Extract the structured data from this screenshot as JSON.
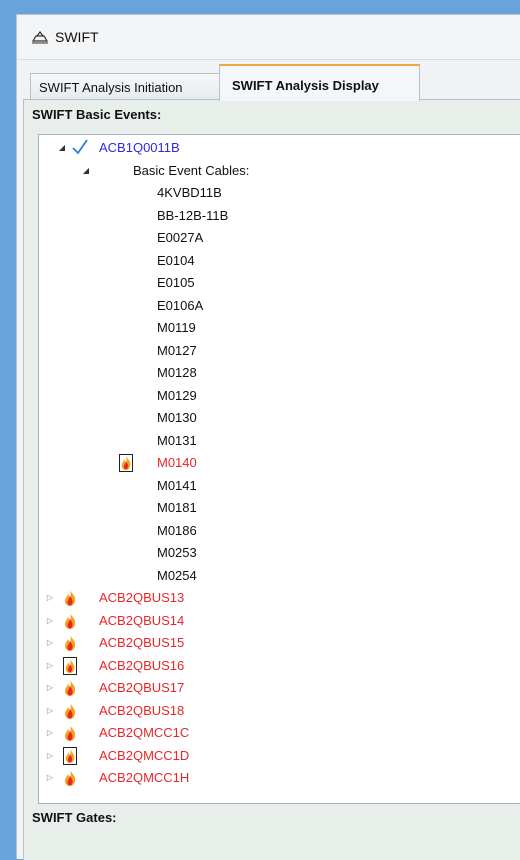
{
  "window": {
    "title": "SWIFT"
  },
  "tabs": [
    {
      "label": "SWIFT Analysis Initiation",
      "active": false
    },
    {
      "label": "SWIFT Analysis Display",
      "active": true
    }
  ],
  "basic_events_header": "SWIFT Basic Events:",
  "gates_header": "SWIFT Gates:",
  "root_event": {
    "label": "ACB1Q0011B",
    "status": "checked",
    "color": "#2b2be0"
  },
  "cables_header": "Basic Event Cables:",
  "cables": [
    {
      "label": "4KVBD11B",
      "flagged": false
    },
    {
      "label": "BB-12B-11B",
      "flagged": false
    },
    {
      "label": "E0027A",
      "flagged": false
    },
    {
      "label": "E0104",
      "flagged": false
    },
    {
      "label": "E0105",
      "flagged": false
    },
    {
      "label": "E0106A",
      "flagged": false
    },
    {
      "label": "M0119",
      "flagged": false
    },
    {
      "label": "M0127",
      "flagged": false
    },
    {
      "label": "M0128",
      "flagged": false
    },
    {
      "label": "M0129",
      "flagged": false
    },
    {
      "label": "M0130",
      "flagged": false
    },
    {
      "label": "M0131",
      "flagged": false
    },
    {
      "label": "M0140",
      "flagged": true
    },
    {
      "label": "M0141",
      "flagged": false
    },
    {
      "label": "M0181",
      "flagged": false
    },
    {
      "label": "M0186",
      "flagged": false
    },
    {
      "label": "M0253",
      "flagged": false
    },
    {
      "label": "M0254",
      "flagged": false
    }
  ],
  "other_events": [
    {
      "label": "ACB2QBUS13",
      "icon": "fire-icon"
    },
    {
      "label": "ACB2QBUS14",
      "icon": "fire-icon"
    },
    {
      "label": "ACB2QBUS15",
      "icon": "fire-icon"
    },
    {
      "label": "ACB2QBUS16",
      "icon": "fire-box-icon"
    },
    {
      "label": "ACB2QBUS17",
      "icon": "fire-icon"
    },
    {
      "label": "ACB2QBUS18",
      "icon": "fire-icon"
    },
    {
      "label": "ACB2QMCC1C",
      "icon": "fire-icon"
    },
    {
      "label": "ACB2QMCC1D",
      "icon": "fire-box-icon"
    },
    {
      "label": "ACB2QMCC1H",
      "icon": "fire-icon"
    }
  ],
  "colors": {
    "event_failed": "#e8262a",
    "event_root": "#2b2be0",
    "checkmark": "#2a7fd4",
    "tab_accent": "#f0a63a",
    "panel_bg": "#e8efea"
  }
}
